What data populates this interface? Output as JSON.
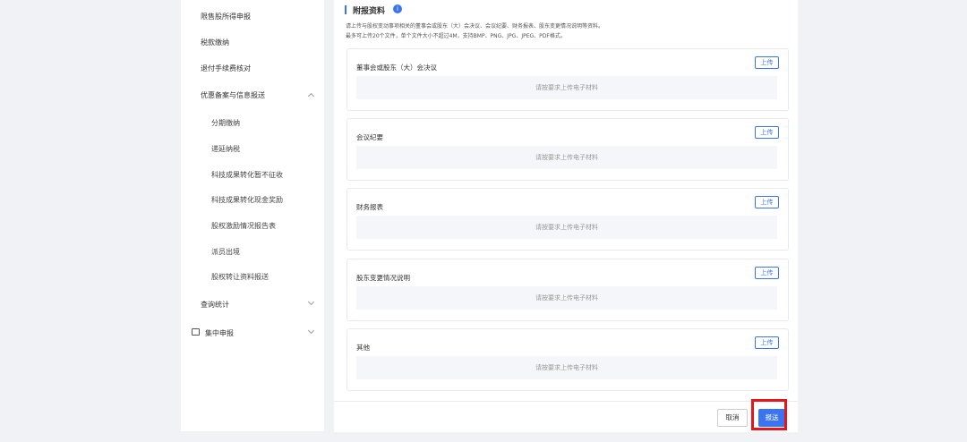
{
  "sidebar": {
    "items": [
      {
        "label": "限售股所得申报",
        "level": 1
      },
      {
        "label": "税款缴纳",
        "level": 1
      },
      {
        "label": "退付手续费核对",
        "level": 1
      },
      {
        "label": "优惠备案与信息报送",
        "level": 1,
        "expanded": true
      },
      {
        "label": "分期缴纳",
        "level": 2
      },
      {
        "label": "递延纳税",
        "level": 2
      },
      {
        "label": "科技成果转化暂不征收",
        "level": 2
      },
      {
        "label": "科技成果转化现金奖励",
        "level": 2
      },
      {
        "label": "股权激励情况报告表",
        "level": 2
      },
      {
        "label": "派员出境",
        "level": 2
      },
      {
        "label": "股权转让资料报送",
        "level": 2
      },
      {
        "label": "查询统计",
        "level": 1,
        "expanded": false
      },
      {
        "label": "集中申报",
        "level": 0,
        "expanded": false
      }
    ]
  },
  "section": {
    "title": "附报资料",
    "info_icon": "i",
    "desc_line1": "请上传与股权变动事项相关的董事会或股东（大）会决议、会议纪要、财务报表、股东变更情况说明等资料。",
    "desc_line2": "最多可上传20个文件，单个文件大小不超过4M，支持BMP、PNG、JPG、JPEG、PDF格式。"
  },
  "cards": [
    {
      "title": "董事会或股东（大）会决议",
      "upload_label": "上传",
      "placeholder": "请按要求上传电子材料"
    },
    {
      "title": "会议纪要",
      "upload_label": "上传",
      "placeholder": "请按要求上传电子材料"
    },
    {
      "title": "财务报表",
      "upload_label": "上传",
      "placeholder": "请按要求上传电子材料"
    },
    {
      "title": "股东变更情况说明",
      "upload_label": "上传",
      "placeholder": "请按要求上传电子材料"
    },
    {
      "title": "其他",
      "upload_label": "上传",
      "placeholder": "请按要求上传电子材料"
    }
  ],
  "footer": {
    "cancel_label": "取消",
    "submit_label": "报送"
  },
  "colors": {
    "accent": "#3b74f1",
    "highlight": "#e8141b"
  }
}
